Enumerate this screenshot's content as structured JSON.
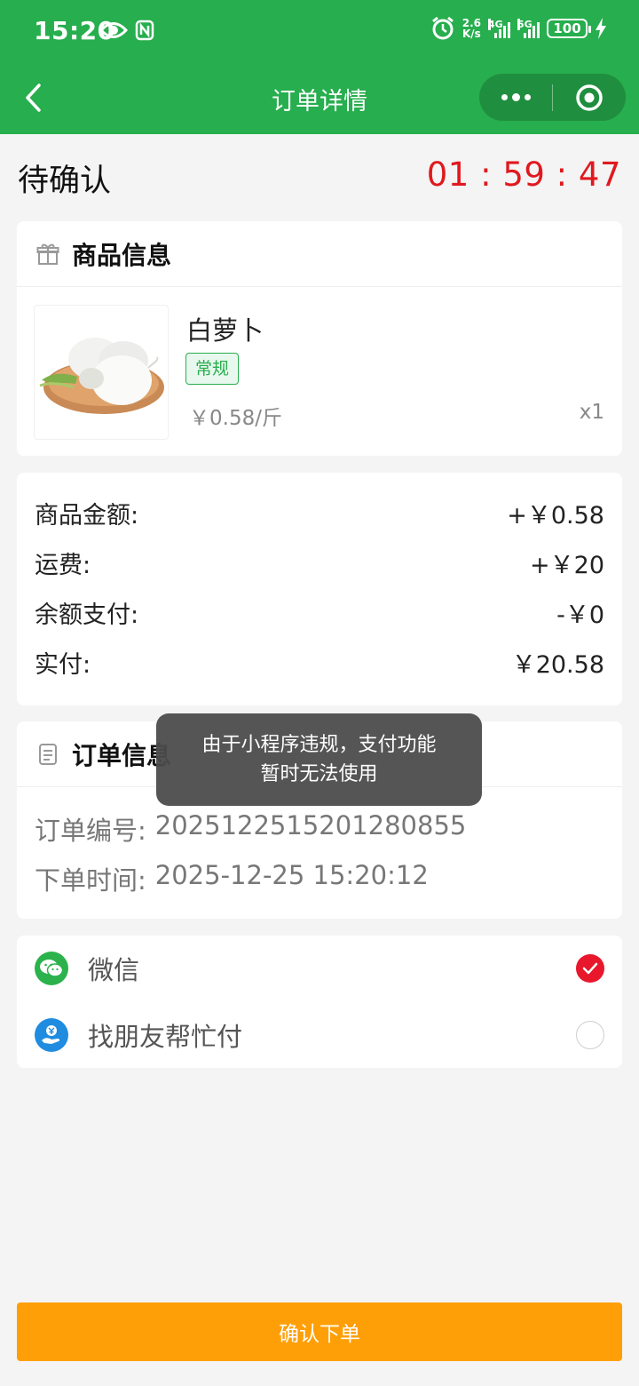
{
  "status_bar": {
    "time": "15:20",
    "net_speed_top": "2.6",
    "net_speed_bottom": "K/s",
    "sig1_label": "4G",
    "sig2_label": "5G",
    "battery": "100"
  },
  "nav": {
    "title": "订单详情"
  },
  "order_status": {
    "title": "待确认",
    "countdown": "01 : 59 : 47"
  },
  "product_section": {
    "title": "商品信息",
    "product": {
      "name": "白萝卜",
      "tag": "常规",
      "price": "￥0.58/斤",
      "quantity": "x1"
    }
  },
  "amounts": [
    {
      "label": "商品金额:",
      "value": "+￥0.58"
    },
    {
      "label": "运费:",
      "value": "+￥20"
    },
    {
      "label": "余额支付:",
      "value": "-￥0"
    },
    {
      "label": "实付:",
      "value": "￥20.58"
    }
  ],
  "order_info": {
    "title": "订单信息",
    "number_label": "订单编号:",
    "number_value": "2025122515201280855",
    "time_label": "下单时间:",
    "time_value": "2025-12-25 15:20:12"
  },
  "payment": {
    "options": [
      {
        "label": "微信",
        "selected": true
      },
      {
        "label": "找朋友帮忙付",
        "selected": false
      }
    ]
  },
  "toast": {
    "line1": "由于小程序违规，支付功能",
    "line2": "暂时无法使用"
  },
  "confirm_button": "确认下单",
  "colors": {
    "brand_green": "#27ae4e",
    "countdown_red": "#e0191e",
    "confirm_orange": "#ff9f07",
    "radio_selected": "#e8172b"
  }
}
